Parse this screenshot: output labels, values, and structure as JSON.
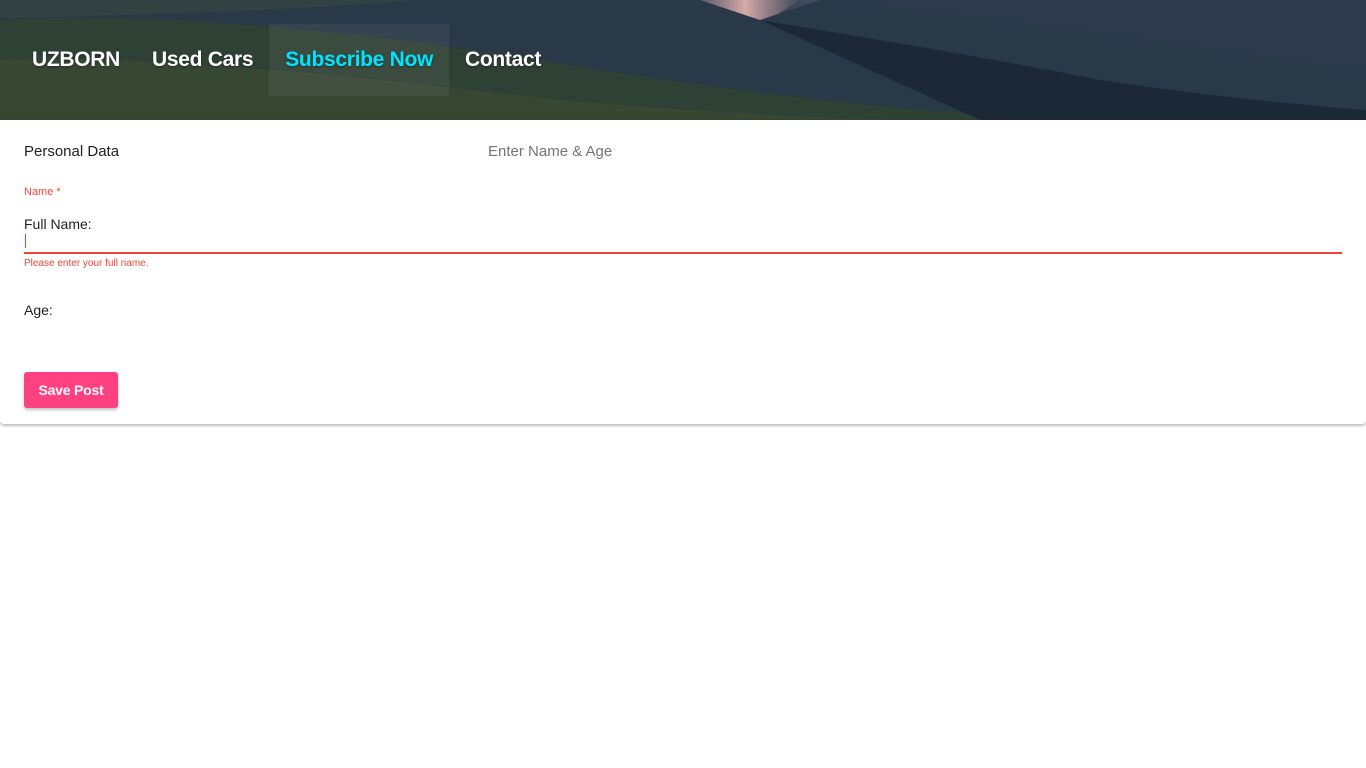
{
  "nav": {
    "brand": "UZBORN",
    "items": [
      {
        "label": "Used Cars",
        "active": false
      },
      {
        "label": "Subscribe Now",
        "active": true
      },
      {
        "label": "Contact",
        "active": false
      }
    ],
    "active_color": "#00e5ff"
  },
  "card": {
    "title": "Personal Data",
    "subtitle": "Enter Name & Age"
  },
  "form": {
    "name": {
      "float_label": "Name *",
      "label": "Full Name:",
      "value": "",
      "error": "Please enter your full name."
    },
    "age": {
      "label": "Age:",
      "value": ""
    },
    "save_label": "Save Post"
  },
  "colors": {
    "error": "#f44336",
    "accent": "#ff4081"
  }
}
